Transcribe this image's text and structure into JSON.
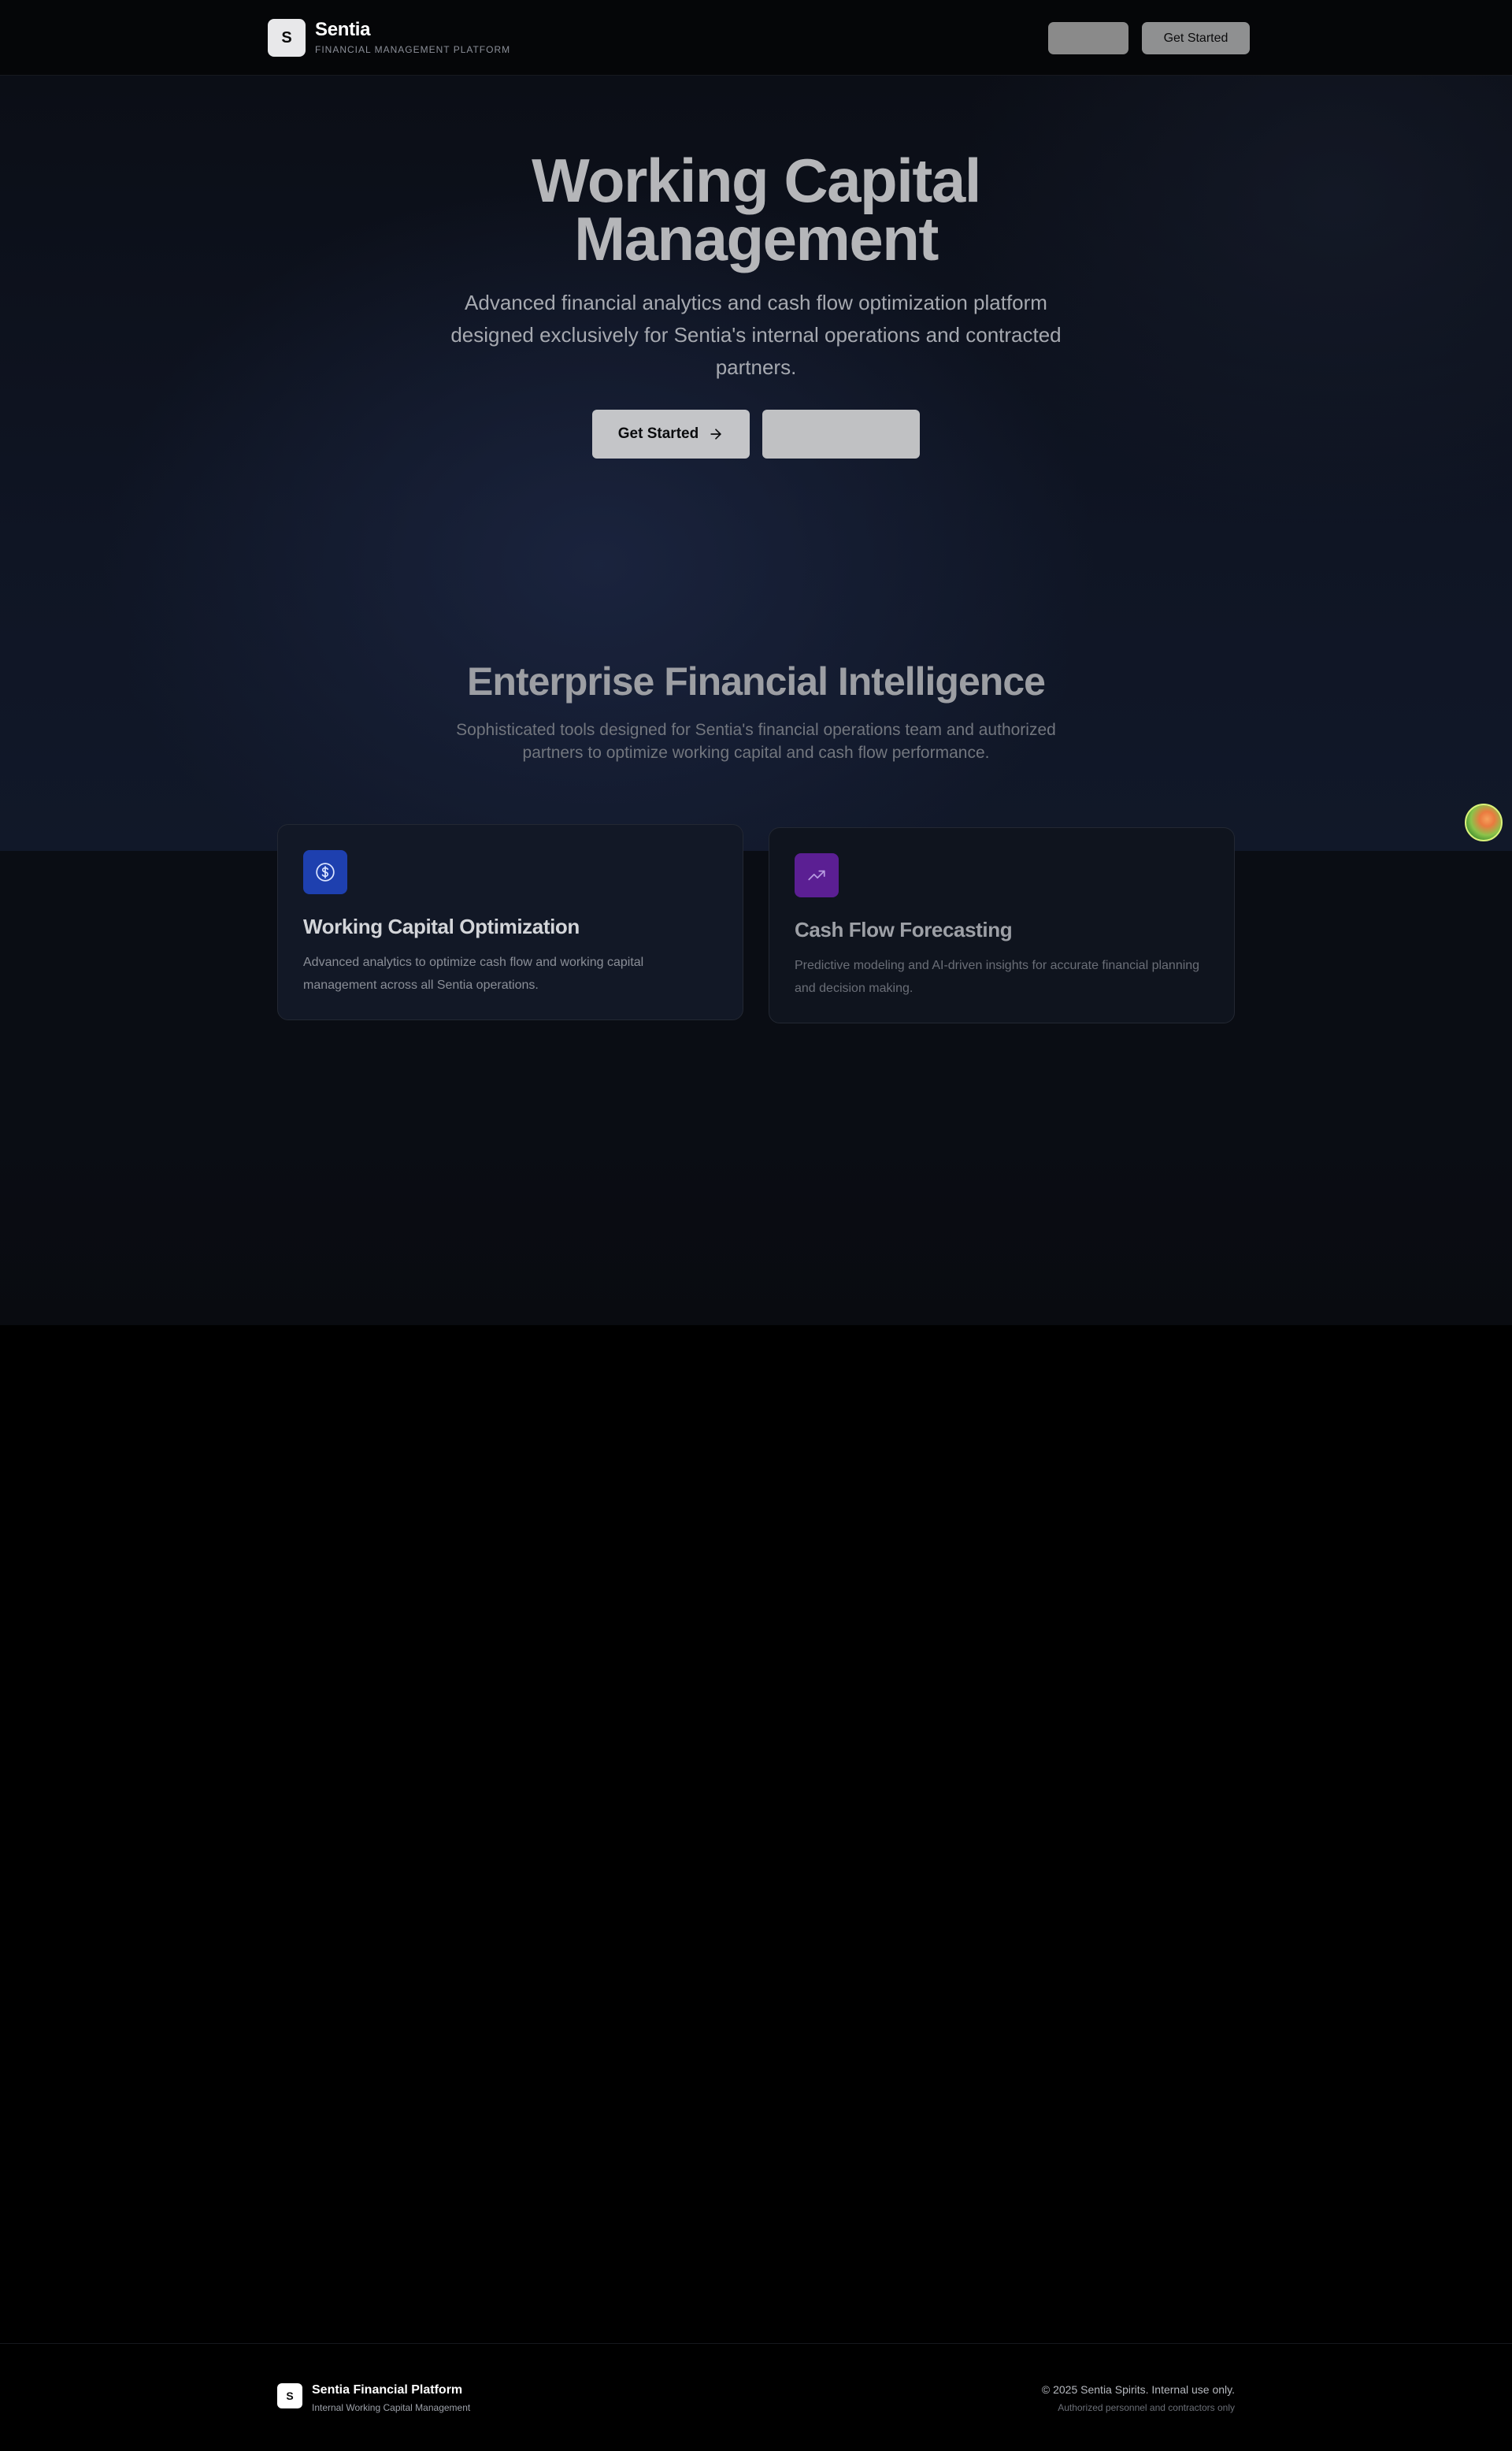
{
  "nav": {
    "logo_letter": "S",
    "brand_name": "Sentia",
    "brand_tagline": "FINANCIAL MANAGEMENT PLATFORM",
    "ghost_button_label": "",
    "primary_button_label": "Get Started"
  },
  "hero": {
    "title_line1": "Working Capital",
    "title_line2": "Management",
    "subtitle": "Advanced financial analytics and cash flow optimization platform designed exclusively for Sentia's internal operations and contracted partners.",
    "primary_button_label": "Get Started",
    "primary_button_icon": "arrow-right-icon",
    "secondary_button_label": ""
  },
  "features": {
    "title": "Enterprise Financial Intelligence",
    "subtitle": "Sophisticated tools designed for Sentia's financial operations team and authorized partners to optimize working capital and cash flow performance.",
    "cards": [
      {
        "icon": "dollar-circle-icon",
        "icon_color": "#1e40af",
        "title": "Working Capital Optimization",
        "description": "Advanced analytics to optimize cash flow and working capital management across all Sentia operations."
      },
      {
        "icon": "trending-up-icon",
        "icon_color": "#5b1f93",
        "title": "Cash Flow Forecasting",
        "description": "Predictive modeling and AI-driven insights for accurate financial planning and decision making."
      }
    ]
  },
  "footer": {
    "logo_letter": "S",
    "name": "Sentia Financial Platform",
    "tagline": "Internal Working Capital Management",
    "copyright": "© 2025 Sentia Spirits. Internal use only.",
    "note": "Authorized personnel and contractors only"
  }
}
